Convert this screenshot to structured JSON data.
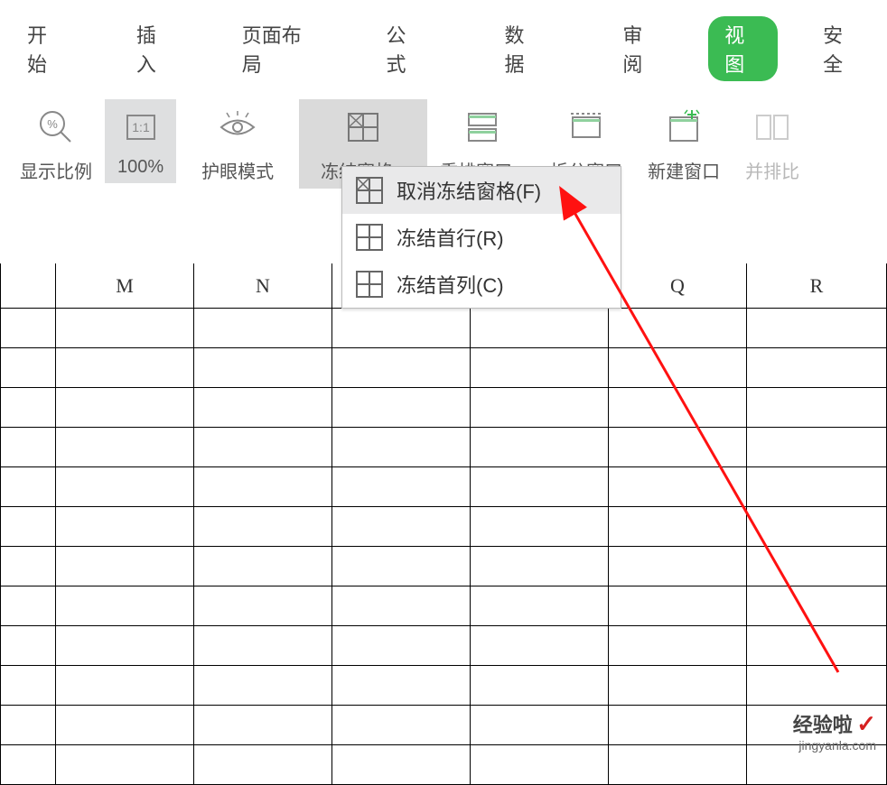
{
  "tabs": {
    "start": "开始",
    "insert": "插入",
    "page_layout": "页面布局",
    "formula": "公式",
    "data": "数据",
    "review": "审阅",
    "view": "视图",
    "security": "安全"
  },
  "ribbon": {
    "zoom_ratio": "显示比例",
    "zoom_100": "100%",
    "eye_protection": "护眼模式",
    "freeze_panes": "冻结窗格",
    "arrange_windows": "重排窗口",
    "split_window": "拆分窗口",
    "new_window": "新建窗口",
    "side_by_side": "并排比"
  },
  "dropdown": {
    "unfreeze": "取消冻结窗格(F)",
    "freeze_top_row": "冻结首行(R)",
    "freeze_first_col": "冻结首列(C)"
  },
  "columns": [
    "M",
    "N",
    "Q",
    "R"
  ],
  "watermark": {
    "title": "经验啦",
    "domain": "jingyanla.com"
  }
}
